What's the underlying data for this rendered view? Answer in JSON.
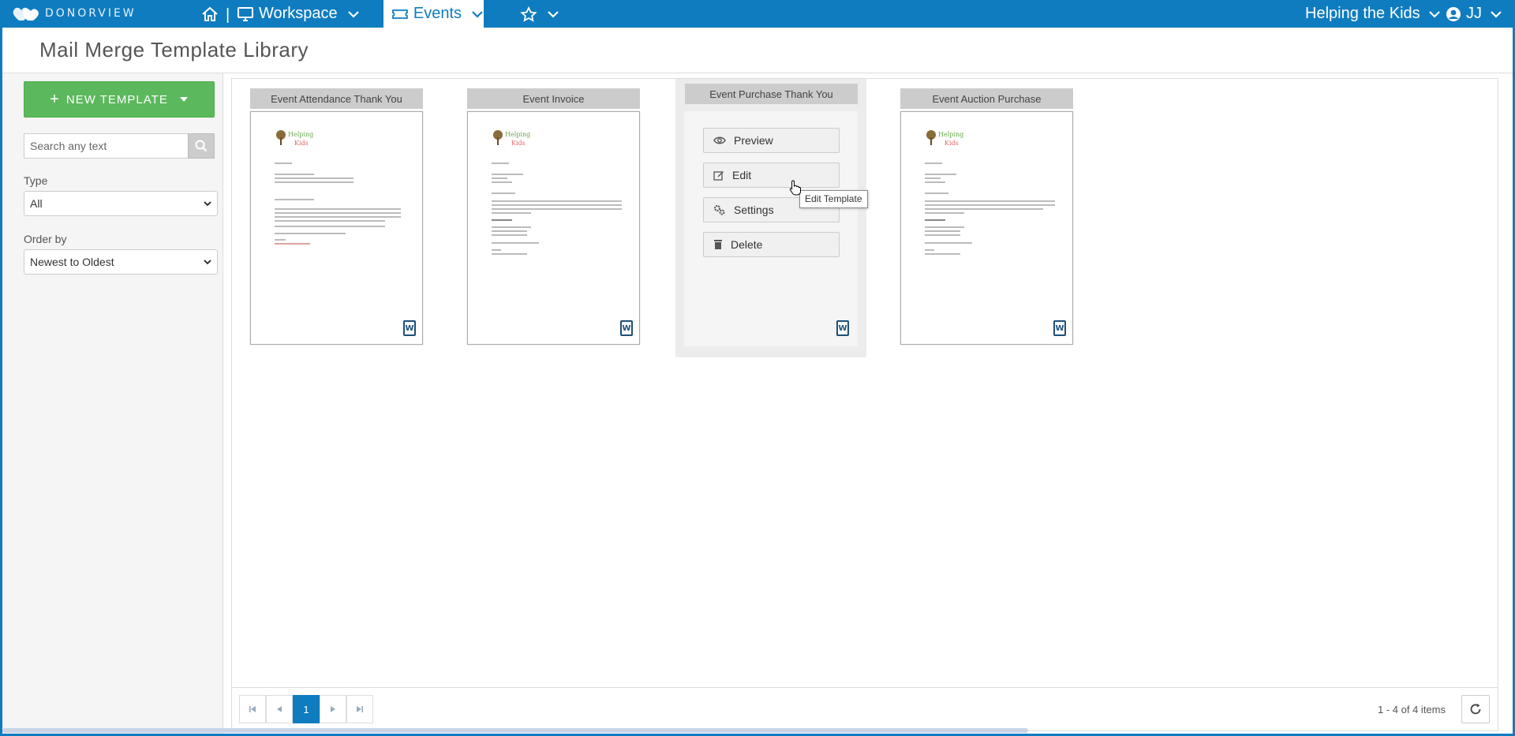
{
  "nav": {
    "logo_text": "DONORVIEW",
    "workspace_label": "Workspace",
    "separator": "|",
    "events_label": "Events",
    "org_label": "Helping the Kids",
    "user_initials": "JJ"
  },
  "page": {
    "title": "Mail Merge Template Library"
  },
  "sidebar": {
    "new_template_label": "NEW TEMPLATE",
    "search_placeholder": "Search any text",
    "type_label": "Type",
    "type_value": "All",
    "order_label": "Order by",
    "order_value": "Newest to Oldest"
  },
  "templates": [
    {
      "title": "Event Attendance Thank You",
      "doc_logo_top": "Helping",
      "doc_logo_bottom": "Kids"
    },
    {
      "title": "Event Invoice",
      "doc_logo_top": "Helping",
      "doc_logo_bottom": "Kids"
    },
    {
      "title": "Event Purchase Thank You"
    },
    {
      "title": "Event Auction Purchase",
      "doc_logo_top": "Helping",
      "doc_logo_bottom": "Kids"
    }
  ],
  "actions": {
    "preview": "Preview",
    "edit": "Edit",
    "settings": "Settings",
    "delete": "Delete",
    "tooltip": "Edit Template"
  },
  "pager": {
    "current_page": "1",
    "items_text": "1 - 4 of 4 items"
  },
  "colors": {
    "brand": "#0f7cc0",
    "new_button": "#5cb85c"
  }
}
